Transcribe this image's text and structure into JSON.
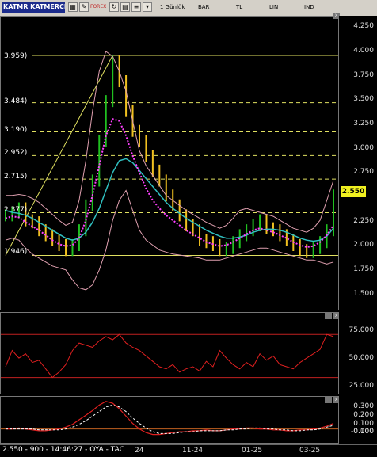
{
  "toolbar": {
    "symbol": "KATMR KATMERCI",
    "icons": [
      "sheet-icon",
      "edit-icon",
      "refresh-icon",
      "doc-icon"
    ],
    "forex_label": "FOREX",
    "period": "1 Günlük",
    "chart_style": "BAR",
    "currency": "TL",
    "scale": "LIN",
    "indicator": "IND"
  },
  "colors": {
    "price_bars_up": "#20c020",
    "price_bars_down": "#f0c020",
    "bollinger": "#e0a0b0",
    "ma_dotted": "#ff40ff",
    "ma_cyan": "#30c0c0",
    "fib_lines": "#e0e060",
    "rsi": "#e02020",
    "macd_line": "#e02020",
    "macd_signal": "#ffffff",
    "price_badge": "#f0f020"
  },
  "main_pane": {
    "fib_levels": [
      "3.959)",
      "3.484)",
      "3.190)",
      "2.952)",
      "2.715)",
      "2.377)",
      "1.946)"
    ],
    "y_ticks": [
      "4.250",
      "4.000",
      "3.750",
      "3.500",
      "3.250",
      "3.000",
      "2.750",
      "2.500",
      "2.250",
      "2.000",
      "1.750",
      "1.500"
    ],
    "last_price": "2.550"
  },
  "rsi_pane": {
    "y_ticks": [
      "75.000",
      "50.000",
      "25.000"
    ]
  },
  "macd_pane": {
    "y_ticks": [
      "0.300",
      "0.200",
      "0.100",
      "0.000",
      "-0.100"
    ]
  },
  "status": {
    "text": "2.550 - 900 - 14:46:27 - OYA - TAC",
    "dates": [
      "24",
      "11-24",
      "01-25",
      "03-25"
    ]
  },
  "chart_data": [
    {
      "type": "line",
      "name": "main-price",
      "ylim": [
        1.4,
        4.35
      ],
      "fib_values": [
        3.959,
        3.484,
        3.19,
        2.952,
        2.715,
        2.377,
        1.946
      ],
      "series": [
        {
          "name": "price",
          "values": [
            2.35,
            2.38,
            2.42,
            2.3,
            2.28,
            2.2,
            2.15,
            2.1,
            2.05,
            2.0,
            2.05,
            2.2,
            2.45,
            2.7,
            3.1,
            3.5,
            3.9,
            3.7,
            3.4,
            3.2,
            3.1,
            2.95,
            2.8,
            2.7,
            2.55,
            2.45,
            2.35,
            2.25,
            2.2,
            2.1,
            2.08,
            2.05,
            2.0,
            2.02,
            2.08,
            2.15,
            2.2,
            2.25,
            2.3,
            2.22,
            2.2,
            2.15,
            2.1,
            2.05,
            2.0,
            1.98,
            2.02,
            2.08,
            2.2,
            2.55
          ]
        },
        {
          "name": "ma-cyan",
          "values": [
            2.4,
            2.38,
            2.37,
            2.35,
            2.32,
            2.28,
            2.24,
            2.2,
            2.16,
            2.12,
            2.1,
            2.12,
            2.18,
            2.28,
            2.42,
            2.6,
            2.78,
            2.9,
            2.92,
            2.88,
            2.8,
            2.72,
            2.64,
            2.56,
            2.48,
            2.42,
            2.37,
            2.32,
            2.28,
            2.24,
            2.2,
            2.17,
            2.14,
            2.12,
            2.12,
            2.13,
            2.15,
            2.18,
            2.2,
            2.21,
            2.21,
            2.2,
            2.18,
            2.15,
            2.12,
            2.1,
            2.09,
            2.1,
            2.14,
            2.22
          ]
        },
        {
          "name": "ma-dotted",
          "values": [
            2.32,
            2.34,
            2.33,
            2.28,
            2.24,
            2.2,
            2.15,
            2.1,
            2.06,
            2.04,
            2.05,
            2.12,
            2.3,
            2.55,
            2.85,
            3.15,
            3.32,
            3.3,
            3.15,
            2.95,
            2.78,
            2.62,
            2.5,
            2.42,
            2.35,
            2.3,
            2.25,
            2.2,
            2.16,
            2.12,
            2.08,
            2.06,
            2.04,
            2.05,
            2.08,
            2.12,
            2.16,
            2.2,
            2.22,
            2.2,
            2.18,
            2.15,
            2.12,
            2.08,
            2.05,
            2.03,
            2.04,
            2.08,
            2.15,
            2.25
          ]
        },
        {
          "name": "bb-upper",
          "values": [
            2.55,
            2.55,
            2.56,
            2.55,
            2.52,
            2.48,
            2.42,
            2.36,
            2.3,
            2.25,
            2.28,
            2.5,
            2.9,
            3.4,
            3.8,
            4.0,
            3.95,
            3.8,
            3.6,
            3.3,
            3.0,
            2.85,
            2.75,
            2.65,
            2.55,
            2.5,
            2.45,
            2.4,
            2.36,
            2.32,
            2.28,
            2.25,
            2.22,
            2.25,
            2.32,
            2.4,
            2.42,
            2.4,
            2.38,
            2.36,
            2.34,
            2.3,
            2.26,
            2.22,
            2.2,
            2.18,
            2.22,
            2.3,
            2.5,
            2.7
          ]
        },
        {
          "name": "bb-lower",
          "values": [
            2.1,
            2.12,
            2.1,
            2.02,
            1.96,
            1.92,
            1.88,
            1.84,
            1.82,
            1.8,
            1.7,
            1.62,
            1.6,
            1.65,
            1.8,
            2.0,
            2.3,
            2.5,
            2.6,
            2.4,
            2.2,
            2.1,
            2.05,
            2.0,
            1.98,
            1.96,
            1.95,
            1.94,
            1.93,
            1.92,
            1.9,
            1.9,
            1.9,
            1.92,
            1.94,
            1.96,
            1.98,
            2.0,
            2.02,
            2.02,
            2.0,
            1.98,
            1.96,
            1.94,
            1.92,
            1.9,
            1.9,
            1.88,
            1.86,
            1.88
          ]
        }
      ]
    },
    {
      "type": "line",
      "name": "rsi",
      "ylim": [
        15,
        90
      ],
      "levels": [
        70,
        30
      ],
      "series": [
        {
          "name": "rsi",
          "values": [
            40,
            55,
            48,
            52,
            44,
            46,
            38,
            30,
            35,
            42,
            55,
            62,
            60,
            58,
            64,
            68,
            65,
            70,
            62,
            58,
            55,
            50,
            45,
            40,
            38,
            42,
            35,
            38,
            40,
            36,
            45,
            40,
            55,
            48,
            42,
            38,
            44,
            40,
            52,
            46,
            50,
            42,
            40,
            38,
            44,
            48,
            52,
            56,
            70,
            68
          ]
        }
      ]
    },
    {
      "type": "line",
      "name": "macd",
      "ylim": [
        -0.15,
        0.35
      ],
      "series": [
        {
          "name": "macd",
          "values": [
            0.0,
            0.0,
            0.01,
            0.0,
            -0.01,
            -0.02,
            -0.02,
            -0.01,
            0.0,
            0.02,
            0.05,
            0.1,
            0.15,
            0.2,
            0.26,
            0.3,
            0.28,
            0.22,
            0.14,
            0.06,
            0.0,
            -0.04,
            -0.06,
            -0.06,
            -0.05,
            -0.04,
            -0.03,
            -0.03,
            -0.02,
            -0.02,
            -0.01,
            -0.02,
            -0.02,
            -0.01,
            0.0,
            0.0,
            0.01,
            0.01,
            0.0,
            0.0,
            -0.01,
            -0.01,
            -0.02,
            -0.02,
            -0.01,
            -0.01,
            0.0,
            0.01,
            0.03,
            0.06
          ]
        },
        {
          "name": "signal",
          "values": [
            0.0,
            0.0,
            0.0,
            0.0,
            0.0,
            -0.01,
            -0.01,
            -0.01,
            -0.01,
            0.0,
            0.02,
            0.05,
            0.09,
            0.14,
            0.19,
            0.24,
            0.26,
            0.24,
            0.19,
            0.12,
            0.06,
            0.01,
            -0.03,
            -0.05,
            -0.05,
            -0.05,
            -0.04,
            -0.03,
            -0.03,
            -0.02,
            -0.02,
            -0.02,
            -0.02,
            -0.01,
            -0.01,
            0.0,
            0.0,
            0.01,
            0.01,
            0.0,
            0.0,
            -0.01,
            -0.01,
            -0.02,
            -0.02,
            -0.01,
            -0.01,
            0.0,
            0.02,
            0.04
          ]
        }
      ]
    }
  ]
}
